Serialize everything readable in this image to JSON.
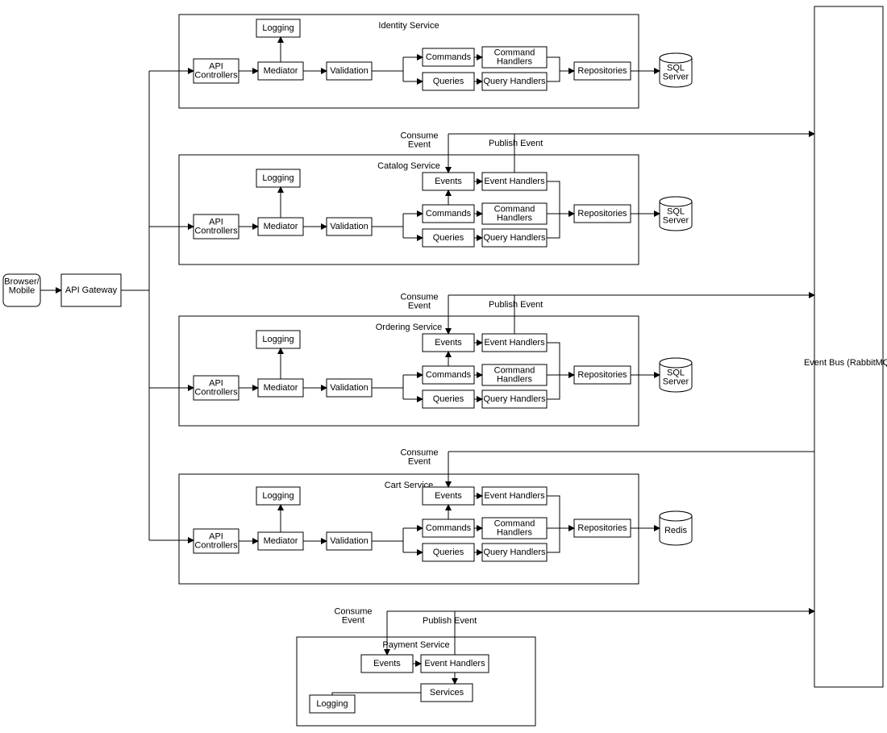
{
  "nodes": {
    "browser": "Browser/\nMobile",
    "gateway": "API Gateway",
    "eventbus": "Event Bus (RabbitMQ)",
    "api_controllers": "API\nControllers",
    "mediator": "Mediator",
    "validation": "Validation",
    "logging": "Logging",
    "commands": "Commands",
    "queries": "Queries",
    "command_handlers": "Command\nHandlers",
    "query_handlers": "Query Handlers",
    "event_handlers": "Event Handlers",
    "events": "Events",
    "repositories": "Repositories",
    "services_box": "Services",
    "sql_server": "SQL\nServer",
    "redis": "Redis"
  },
  "services": {
    "identity": "Identity Service",
    "catalog": "Catalog Service",
    "ordering": "Ordering Service",
    "cart": "Cart Service",
    "payment": "Payment Service"
  },
  "labels": {
    "consume_event": "Consume\nEvent",
    "publish_event": "Publish Event"
  }
}
